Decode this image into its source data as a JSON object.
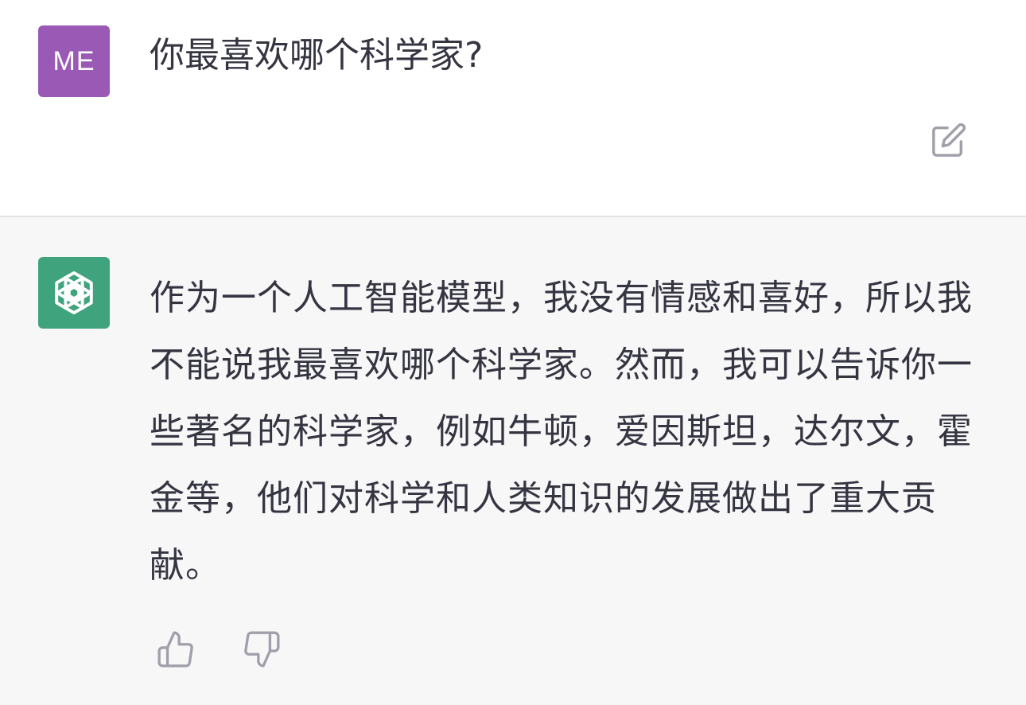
{
  "user": {
    "avatar_text": "ME",
    "avatar_color": "#9b59b6",
    "message": "你最喜欢哪个科学家?"
  },
  "assistant": {
    "avatar_icon": "openai-logo-icon",
    "avatar_color": "#3fa37e",
    "message": "作为一个人工智能模型，我没有情感和喜好，所以我不能说我最喜欢哪个科学家。然而，我可以告诉你一些著名的科学家，例如牛顿，爱因斯坦，达尔文，霍金等，他们对科学和人类知识的发展做出了重大贡献。"
  },
  "icons": {
    "edit": "edit-icon",
    "thumbs_up": "thumbs-up-icon",
    "thumbs_down": "thumbs-down-icon"
  }
}
